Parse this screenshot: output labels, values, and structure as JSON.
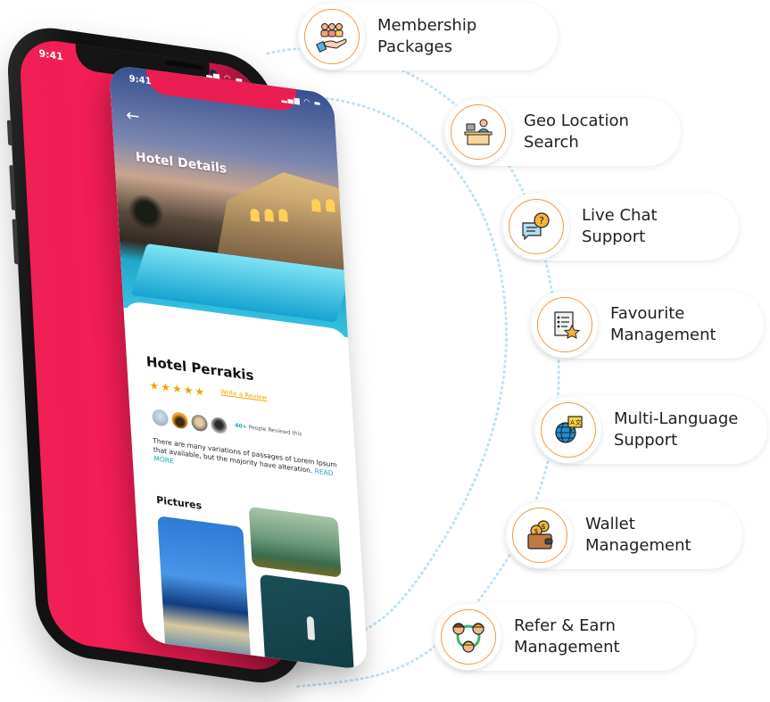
{
  "back_phone": {
    "time": "9:41",
    "status_icons": [
      "signal-icon",
      "wifi-icon",
      "battery-icon"
    ],
    "screen_color": "#f41c55"
  },
  "front_phone": {
    "time": "9:41",
    "status_icons": [
      "signal-icon",
      "wifi-icon",
      "battery-icon"
    ],
    "back_icon": "arrow-left-icon",
    "title": "Hotel Details",
    "hotel_name": "Hotel Perrakis",
    "rating": 5,
    "rating_max": 5,
    "stars": "★★★★★",
    "write_review": "Write a Review",
    "review_count": "40+",
    "review_text": "People Reviewd this",
    "description": "There are many variations of passages of Lorem Ipsum that available, but the majority have alteration.",
    "read_more": "READ MORE",
    "pictures_heading": "Pictures",
    "accent_color": "#1aa3b8",
    "star_color": "#f5a400"
  },
  "features": [
    {
      "icon": "membership-hand-people-icon",
      "line1": "Membership",
      "line2": "Packages"
    },
    {
      "icon": "geo-location-desk-icon",
      "line1": "Geo Location",
      "line2": "Search"
    },
    {
      "icon": "live-chat-question-icon",
      "line1": "Live Chat",
      "line2": "Support"
    },
    {
      "icon": "favourite-list-star-icon",
      "line1": "Favourite",
      "line2": "Management"
    },
    {
      "icon": "multi-language-globe-icon",
      "line1": "Multi-Language",
      "line2": "Support"
    },
    {
      "icon": "wallet-coins-icon",
      "line1": "Wallet",
      "line2": "Management"
    },
    {
      "icon": "refer-earn-people-icon",
      "line1": "Refer & Earn",
      "line2": "Management"
    }
  ],
  "colors": {
    "icon_ring": "#f7963c",
    "dotted_line": "#bfe3f5"
  }
}
